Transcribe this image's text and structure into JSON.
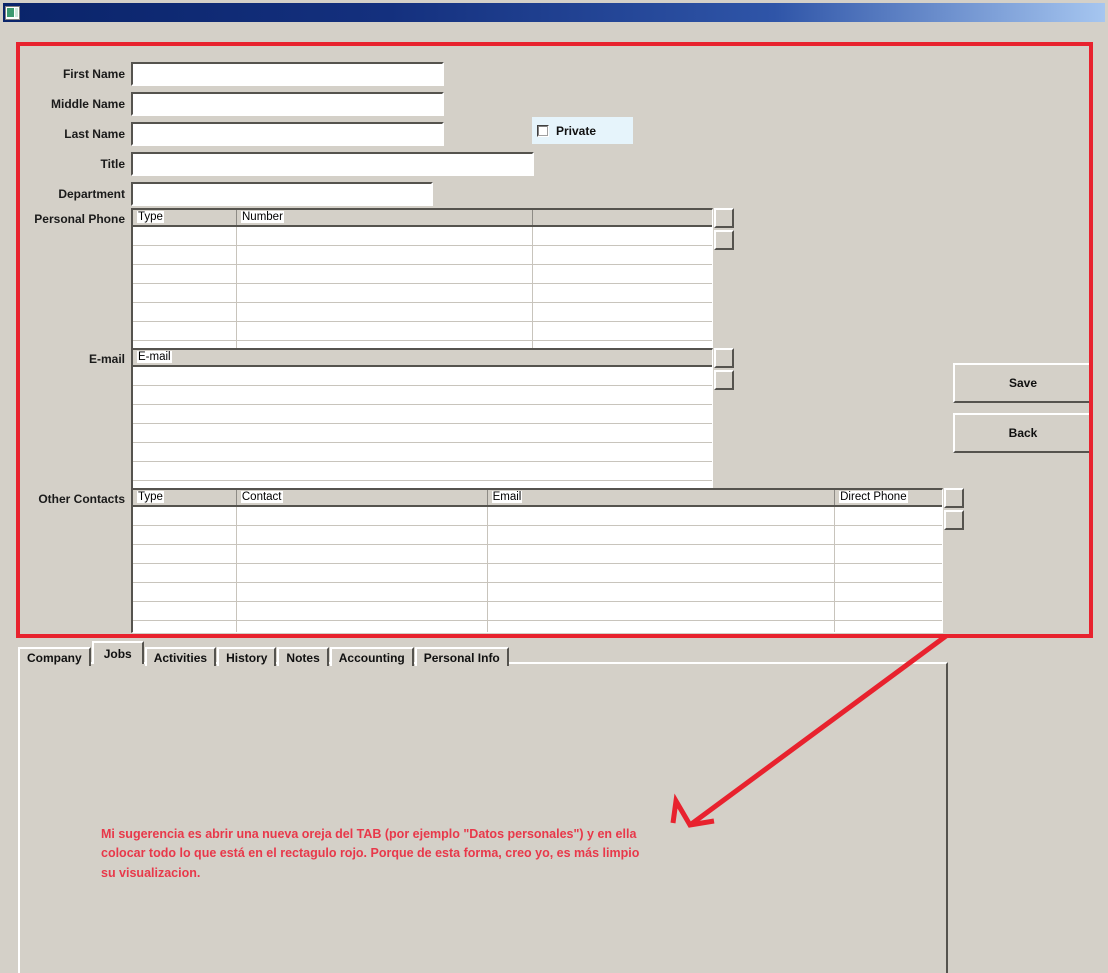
{
  "window": {
    "title": "",
    "icon": "app-icon"
  },
  "form": {
    "fields": [
      {
        "label": "First Name",
        "value": "",
        "placeholder": ""
      },
      {
        "label": "Middle Name",
        "value": "",
        "placeholder": ""
      },
      {
        "label": "Last Name",
        "value": "",
        "placeholder": ""
      },
      {
        "label": "Title",
        "value": "",
        "placeholder": ""
      },
      {
        "label": "Department",
        "value": "",
        "placeholder": ""
      }
    ],
    "private_checkbox": {
      "label": "Private",
      "checked": false
    },
    "grids": [
      {
        "label": "Personal Phone",
        "columns": [
          "Type",
          "Number",
          ""
        ],
        "rows": [],
        "row_count": 6
      },
      {
        "label": "E-mail",
        "columns": [
          "E-mail"
        ],
        "rows": [],
        "row_count": 6
      },
      {
        "label": "Other Contacts",
        "columns": [
          "Type",
          "Contact",
          "Email",
          "Direct Phone"
        ],
        "rows": [],
        "row_count": 6
      }
    ],
    "buttons": [
      {
        "label": "Save"
      },
      {
        "label": "Back"
      }
    ]
  },
  "tabs": {
    "items": [
      {
        "label": "Company",
        "active": false
      },
      {
        "label": "Jobs",
        "active": true
      },
      {
        "label": "Activities",
        "active": false
      },
      {
        "label": "History",
        "active": false
      },
      {
        "label": "Notes",
        "active": false
      },
      {
        "label": "Accounting",
        "active": false
      },
      {
        "label": "Personal Info",
        "active": false
      }
    ]
  },
  "annotation": {
    "text": "Mi sugerencia es abrir una nueva oreja del TAB (por ejemplo \"Datos personales\") y en ella colocar todo lo que está en el rectagulo rojo. Porque de esta forma, creo yo, es más limpio su visualizacion.",
    "color": "#e8384a",
    "rect_color": "#e8222e"
  },
  "colors": {
    "window_background": "#d4d0c8",
    "titlebar_start": "#0a246a",
    "titlebar_end": "#a6c6f0",
    "field_background": "#ffffff",
    "private_panel": "#e6f4fb",
    "annotation_red": "#e8222e"
  }
}
